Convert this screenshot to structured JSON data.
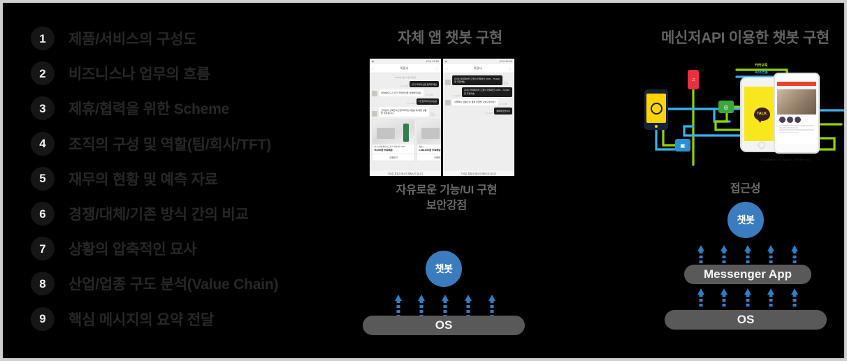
{
  "slide": {
    "background_color": "#000000",
    "border_color": "#d0d0d0"
  },
  "left_list": {
    "items": [
      {
        "number": "1",
        "label": "제품/서비스의 구성도"
      },
      {
        "number": "2",
        "label": "비즈니스나 업무의 흐름"
      },
      {
        "number": "3",
        "label": "제휴/협력을 위한 Scheme"
      },
      {
        "number": "4",
        "label": "조직의 구성 및 역할(팀/회사/TFT)"
      },
      {
        "number": "5",
        "label": "재무의 현황 및 예측 자료"
      },
      {
        "number": "6",
        "label": "경쟁/대체/기존 방식 간의 비교"
      },
      {
        "number": "7",
        "label": "상황의 압축적인 묘사"
      },
      {
        "number": "8",
        "label": "산업/업종 구도 분석(Value Chain)"
      },
      {
        "number": "9",
        "label": "핵심 메시지의 요약 전달"
      }
    ]
  },
  "center_column": {
    "title": "자체 앱 챗봇 구현",
    "caption_line1": "자유로운 기능/UI 구현",
    "caption_line2": "보안강점",
    "stack": {
      "bot_label": "챗봇",
      "os_label": "OS",
      "arrow_count_os_to_bot": 5,
      "accent_color": "#2f7fc4",
      "bar_color": "#595959"
    },
    "phones": [
      {
        "status_left": "icon",
        "status_right": "61% 23:56",
        "nav_title": "톡집사",
        "nav_back": "‹",
        "nav_more": "⋮",
        "daystamp": "2018년 9월 11일 화요일",
        "messages": [
          {
            "side": "right",
            "tone": "dark",
            "text": "인기 커피머신을 알려주세요",
            "time": "오후 11:51"
          },
          {
            "side": "left",
            "tone": "light",
            "text": "아래에서 드신 인기 커피머신을 선택해주세요.",
            "time": "오후 11:52"
          },
          {
            "side": "right",
            "tone": "dark",
            "text": "#드립커피머신#쇼핑",
            "time": "오후 11:53"
          },
          {
            "side": "left",
            "tone": "light",
            "text": "고객님이 선택한 #드립커피머신 #캡슐 에 대한 상품을 추천합니다.",
            "time": "오후 11:53"
          }
        ],
        "cards": [
          {
            "desc": "[쿠쿠] 커피메이커 드립식 커피머신 CMS...",
            "price": "76,000원",
            "shipping": "무료배송",
            "button": "구매하기"
          },
          {
            "desc": "[캡슐]...",
            "price": "1,561,800원",
            "shipping": "무료배송",
            "button": "구매하기"
          }
        ],
        "footer": "지금은 톡집사 메시지 채팅시간 입니다"
      },
      {
        "status_left": "icon",
        "status_right": "61% 23:56",
        "nav_title": "톡집사",
        "nav_back": "‹",
        "nav_more": "⋮",
        "daystamp": "",
        "messages": [
          {
            "side": "left",
            "tone": "dark",
            "text": "[쿠쿠] 커피메이커 드립식 커피머신 CMS... 76,000원 무료배송",
            "time": "오후 11:55"
          },
          {
            "side": "right",
            "tone": "dark",
            "text": "[쿠쿠] 커피메이커 드립식 커피머신 CMS... 76,000원 무료배송",
            "time": "오후 11:56"
          },
          {
            "side": "left",
            "tone": "light",
            "text": "선택하신 상품으로 결제 진행을 도와드릴까요?",
            "time": "오후 11:56"
          },
          {
            "side": "right",
            "tone": "dark",
            "text": "결제하겠습니다",
            "time": "오후 11:56"
          }
        ],
        "cards": [],
        "footer": "지금은 톡집사 메시지 채팅시간 입니다"
      }
    ]
  },
  "right_column": {
    "title": "메신저API 이용한 챗봇 구현",
    "caption_line1": "접근성",
    "stack": {
      "bot_label": "챗봇",
      "messenger_label": "Messenger App",
      "os_label": "OS",
      "arrow_count_os_to_messenger": 5,
      "arrow_count_messenger_to_bot": 5,
      "accent_color": "#2f7fc4",
      "bar_color": "#595959"
    },
    "illustration": {
      "talk_logo_text": "TALK",
      "label_green": "카카오톡",
      "label_blue": "App연동",
      "caption": "카카오톡 플러스친구 / 옐로아이디 기반 챗봇 서비스",
      "node_icons": [
        "hub-icon",
        "music-icon",
        "location-icon",
        "camera-icon"
      ],
      "colors": {
        "kakao_yellow": "#f8e71c",
        "line_green": "#8fd400",
        "line_blue": "#36b3ef",
        "red_node": "#e8303f",
        "green_node": "#3aa83a",
        "blue_node": "#2b8fd4",
        "yellow_node": "#ffd400"
      }
    }
  }
}
